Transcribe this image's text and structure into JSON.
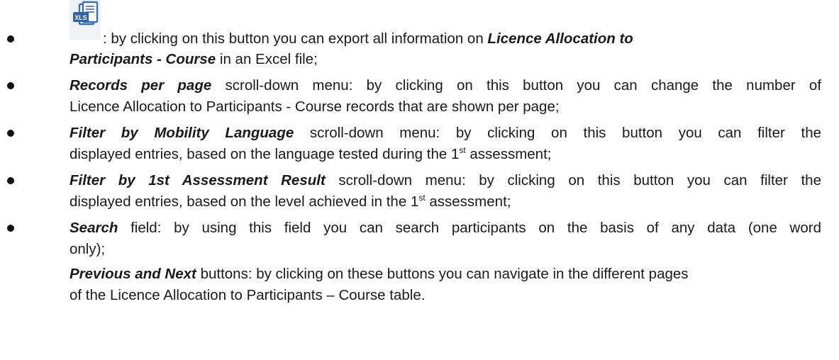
{
  "icon": {
    "name": "xls-export-icon",
    "label": "XLS"
  },
  "bullets": [
    {
      "line1_text": ": by clicking on this button you can export all information on ",
      "line1_strong": "Licence Allocation to",
      "line2_strong": "Participants - Course",
      "line2_text": " in an Excel file;"
    },
    {
      "strong": "Records per page",
      "line1_text": " scroll-down menu: by clicking on this button you can change the number of",
      "line2_text": "Licence Allocation to Participants - Course records that are shown per page;"
    },
    {
      "strong": "Filter by Mobility Language",
      "line1_text": " scroll-down menu: by clicking on this button you can filter the",
      "line2_text_a": "displayed entries, based on the language tested during the 1",
      "line2_sup": "st",
      "line2_text_b": " assessment;"
    },
    {
      "strong": "Filter by 1st Assessment Result",
      "line1_text": " scroll-down menu: by clicking on this button you can filter the",
      "line2_text_a": "displayed entries, based on the level achieved in the 1",
      "line2_sup": "st",
      "line2_text_b": " assessment;"
    },
    {
      "strong": "Search",
      "line1_text": " field: by using this field you can search participants on the basis of any data (one word",
      "line2_text": "only);"
    }
  ],
  "followup": {
    "strong": "Previous and Next",
    "line1_text": " buttons: by clicking on these buttons you can navigate in the different pages",
    "line2_text": "of the Licence Allocation to Participants – Course table."
  }
}
